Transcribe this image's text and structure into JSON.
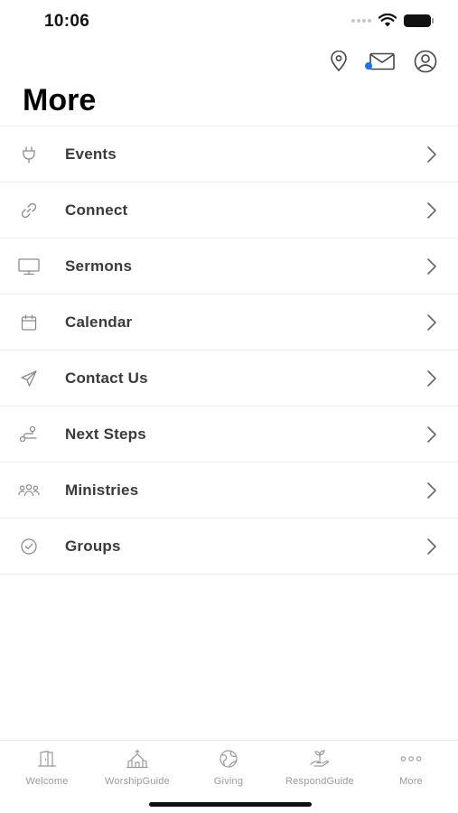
{
  "status_bar": {
    "time": "10:06"
  },
  "header": {
    "icons": [
      "location-pin-icon",
      "mail-icon",
      "user-profile-icon"
    ],
    "unread_dot_color": "#1a73e8"
  },
  "page": {
    "title": "More"
  },
  "menu": {
    "items": [
      {
        "label": "Events",
        "icon": "plug-icon"
      },
      {
        "label": "Connect",
        "icon": "link-icon"
      },
      {
        "label": "Sermons",
        "icon": "monitor-icon"
      },
      {
        "label": "Calendar",
        "icon": "calendar-icon"
      },
      {
        "label": "Contact Us",
        "icon": "paper-plane-icon"
      },
      {
        "label": "Next Steps",
        "icon": "path-icon"
      },
      {
        "label": "Ministries",
        "icon": "people-group-icon"
      },
      {
        "label": "Groups",
        "icon": "check-circle-icon"
      }
    ]
  },
  "tab_bar": {
    "tabs": [
      {
        "label": "Welcome",
        "icon": "door-icon"
      },
      {
        "label": "WorshipGuide",
        "icon": "church-icon"
      },
      {
        "label": "Giving",
        "icon": "globe-icon"
      },
      {
        "label": "RespondGuide",
        "icon": "hand-seedling-icon"
      },
      {
        "label": "More",
        "icon": "ellipsis-icon"
      }
    ]
  },
  "colors": {
    "icon_gray": "#8a8a8a",
    "label_gray": "#3a3a3a",
    "tab_label": "#999999"
  }
}
